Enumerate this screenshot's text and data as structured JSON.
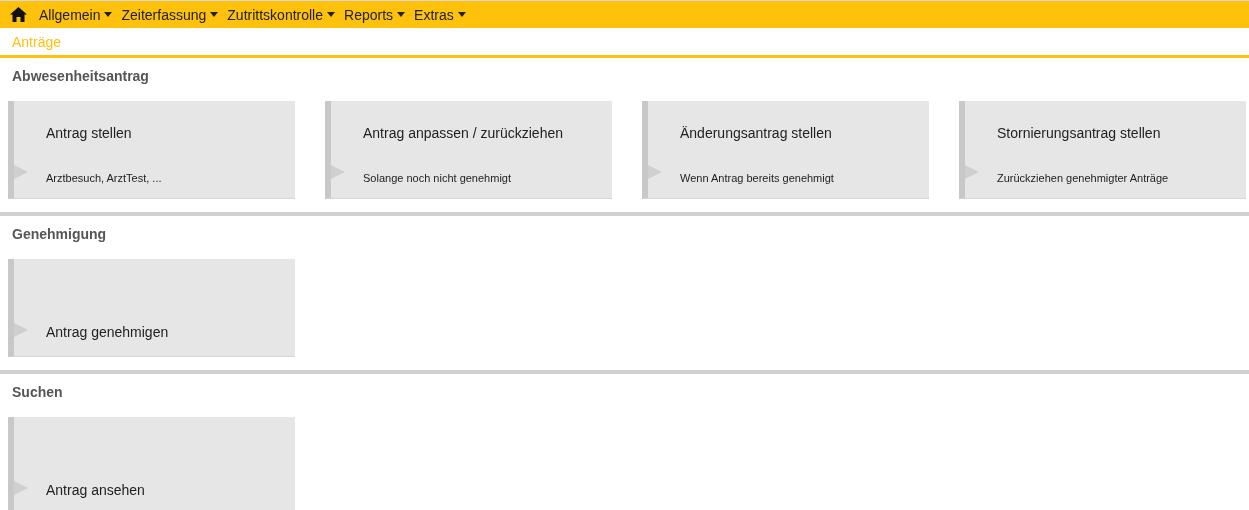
{
  "nav": {
    "menus": [
      {
        "label": "Allgemein"
      },
      {
        "label": "Zeiterfassung"
      },
      {
        "label": "Zutrittskontrolle"
      },
      {
        "label": "Reports"
      },
      {
        "label": "Extras"
      }
    ]
  },
  "breadcrumb": "Anträge",
  "sections": [
    {
      "title": "Abwesenheitsantrag",
      "tiles": [
        {
          "title": "Antrag stellen",
          "subtitle": "Arztbesuch, ArztTest, ..."
        },
        {
          "title": "Antrag anpassen / zurückziehen",
          "subtitle": "Solange noch nicht genehmigt"
        },
        {
          "title": "Änderungsantrag stellen",
          "subtitle": "Wenn Antrag bereits genehmigt"
        },
        {
          "title": "Stornierungsantrag stellen",
          "subtitle": "Zurückziehen genehmigter Anträge"
        }
      ]
    },
    {
      "title": "Genehmigung",
      "tiles": [
        {
          "title": "Antrag genehmigen"
        }
      ]
    },
    {
      "title": "Suchen",
      "tiles": [
        {
          "title": "Antrag ansehen"
        }
      ]
    }
  ]
}
